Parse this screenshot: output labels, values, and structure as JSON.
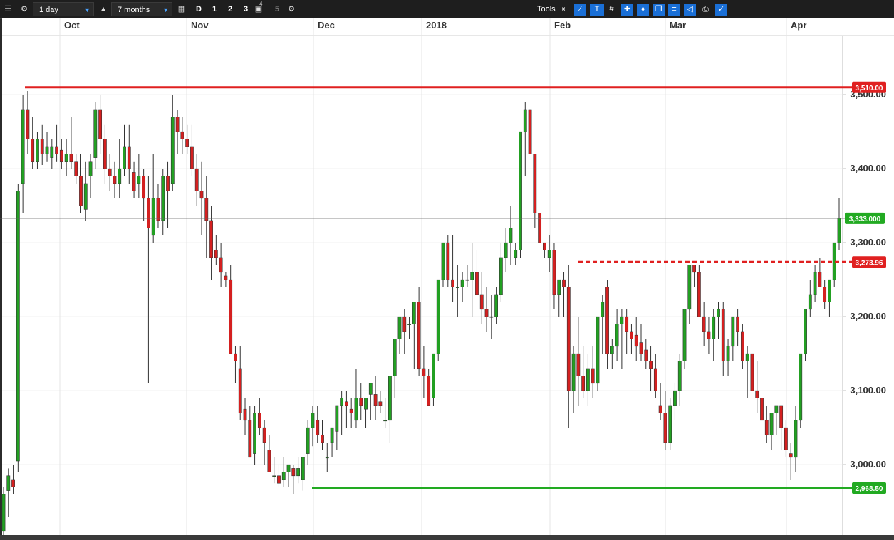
{
  "toolbar": {
    "interval": "1 day",
    "range": "7 months",
    "chart_style_buttons": [
      "D",
      "1",
      "2",
      "3"
    ],
    "sup_label": "4",
    "dim_button": "5",
    "tools_label": "Tools",
    "accent_color": "#1a6fd6",
    "icons": [
      "menu-icon",
      "gear-icon",
      "lock-icon",
      "calendar-icon",
      "layout-icon",
      "settings-icon",
      "back-arrow-icon",
      "trend-line-icon",
      "text-tool-icon",
      "grid-icon",
      "crosshair-icon",
      "marker-icon",
      "copy-icon",
      "fib-icon",
      "tag-icon",
      "print-icon",
      "drawing-tools-icon"
    ]
  },
  "chart_data": {
    "type": "candlestick",
    "x_axis_labels": [
      "Oct",
      "Nov",
      "Dec",
      "2018",
      "Feb",
      "Mar",
      "Apr"
    ],
    "y_tick_labels": [
      "3,500.00",
      "3,400.00",
      "3,300.00",
      "3,200.00",
      "3,100.00",
      "3,000.00"
    ],
    "y_ticks": [
      3500,
      3400,
      3300,
      3200,
      3100,
      3000
    ],
    "ylim": [
      2905,
      3580
    ],
    "colors": {
      "up": "#22a022",
      "down": "#d42020",
      "background": "#ffffff",
      "grid": "#e4e4e4"
    },
    "level_lines": [
      {
        "value": 3510.0,
        "label": "3,510.00",
        "color": "#e02020",
        "style": "solid"
      },
      {
        "value": 3273.96,
        "label": "3,273.96",
        "color": "#e02020",
        "style": "dashed"
      },
      {
        "value": 2968.5,
        "label": "2,968.50",
        "color": "#22aa22",
        "style": "solid"
      }
    ],
    "last_price": {
      "value": 3333.0,
      "label": "3,333.000",
      "color": "#22aa22"
    },
    "candles": [
      [
        2910,
        2970,
        2905,
        2960
      ],
      [
        2965,
        2995,
        2930,
        2985
      ],
      [
        2980,
        3000,
        2960,
        2970
      ],
      [
        3005,
        3380,
        2990,
        3370
      ],
      [
        3380,
        3500,
        3340,
        3480
      ],
      [
        3480,
        3505,
        3420,
        3440
      ],
      [
        3440,
        3470,
        3400,
        3410
      ],
      [
        3410,
        3450,
        3400,
        3440
      ],
      [
        3440,
        3460,
        3405,
        3420
      ],
      [
        3420,
        3450,
        3410,
        3430
      ],
      [
        3415,
        3440,
        3400,
        3430
      ],
      [
        3430,
        3460,
        3410,
        3420
      ],
      [
        3425,
        3440,
        3400,
        3410
      ],
      [
        3410,
        3440,
        3390,
        3420
      ],
      [
        3420,
        3470,
        3400,
        3410
      ],
      [
        3410,
        3420,
        3380,
        3390
      ],
      [
        3390,
        3420,
        3340,
        3350
      ],
      [
        3345,
        3410,
        3330,
        3380
      ],
      [
        3390,
        3420,
        3360,
        3410
      ],
      [
        3415,
        3490,
        3400,
        3480
      ],
      [
        3480,
        3500,
        3420,
        3440
      ],
      [
        3440,
        3460,
        3380,
        3400
      ],
      [
        3400,
        3420,
        3370,
        3390
      ],
      [
        3390,
        3410,
        3360,
        3380
      ],
      [
        3380,
        3440,
        3360,
        3400
      ],
      [
        3400,
        3460,
        3390,
        3430
      ],
      [
        3430,
        3460,
        3380,
        3400
      ],
      [
        3395,
        3410,
        3360,
        3370
      ],
      [
        3380,
        3420,
        3360,
        3390
      ],
      [
        3390,
        3400,
        3330,
        3360
      ],
      [
        3360,
        3390,
        3110,
        3320
      ],
      [
        3310,
        3420,
        3300,
        3360
      ],
      [
        3360,
        3380,
        3320,
        3330
      ],
      [
        3330,
        3400,
        3310,
        3390
      ],
      [
        3390,
        3410,
        3320,
        3370
      ],
      [
        3380,
        3500,
        3370,
        3470
      ],
      [
        3470,
        3480,
        3420,
        3450
      ],
      [
        3450,
        3470,
        3420,
        3440
      ],
      [
        3440,
        3460,
        3420,
        3430
      ],
      [
        3430,
        3460,
        3390,
        3400
      ],
      [
        3400,
        3420,
        3350,
        3370
      ],
      [
        3370,
        3410,
        3310,
        3360
      ],
      [
        3360,
        3390,
        3280,
        3330
      ],
      [
        3330,
        3350,
        3250,
        3280
      ],
      [
        3290,
        3310,
        3270,
        3280
      ],
      [
        3280,
        3300,
        3240,
        3260
      ],
      [
        3255,
        3260,
        3240,
        3250
      ],
      [
        3250,
        3270,
        3200,
        3150
      ],
      [
        3150,
        3160,
        3110,
        3140
      ],
      [
        3130,
        3160,
        3060,
        3070
      ],
      [
        3075,
        3090,
        3040,
        3060
      ],
      [
        3060,
        3080,
        3010,
        3010
      ],
      [
        3015,
        3080,
        3000,
        3070
      ],
      [
        3070,
        3090,
        3040,
        3050
      ],
      [
        3050,
        3060,
        3000,
        3030
      ],
      [
        3020,
        3040,
        2995,
        2990
      ],
      [
        2985,
        3010,
        2975,
        2985
      ],
      [
        2985,
        3000,
        2970,
        2975
      ],
      [
        2980,
        3010,
        2970,
        2990
      ],
      [
        2990,
        3000,
        2970,
        3000
      ],
      [
        2995,
        3000,
        2960,
        2985
      ],
      [
        2985,
        3010,
        2975,
        2995
      ],
      [
        2980,
        3010,
        2965,
        3010
      ],
      [
        3015,
        3060,
        3000,
        3050
      ],
      [
        3050,
        3080,
        3025,
        3070
      ],
      [
        3060,
        3080,
        3030,
        3040
      ],
      [
        3040,
        3060,
        3020,
        3030
      ],
      [
        3010,
        3030,
        2990,
        3010
      ],
      [
        3030,
        3050,
        3010,
        3050
      ],
      [
        3045,
        3070,
        3020,
        3080
      ],
      [
        3080,
        3100,
        3040,
        3090
      ],
      [
        3085,
        3100,
        3050,
        3080
      ],
      [
        3075,
        3090,
        3050,
        3070
      ],
      [
        3060,
        3130,
        3050,
        3090
      ],
      [
        3090,
        3110,
        3060,
        3080
      ],
      [
        3075,
        3090,
        3050,
        3090
      ],
      [
        3095,
        3110,
        3060,
        3110
      ],
      [
        3095,
        3120,
        3060,
        3080
      ],
      [
        3085,
        3100,
        3070,
        3080
      ],
      [
        3060,
        3090,
        3050,
        3060
      ],
      [
        3060,
        3110,
        3030,
        3120
      ],
      [
        3120,
        3130,
        3090,
        3170
      ],
      [
        3170,
        3200,
        3150,
        3200
      ],
      [
        3200,
        3210,
        3150,
        3180
      ],
      [
        3190,
        3200,
        3170,
        3190
      ],
      [
        3190,
        3210,
        3130,
        3220
      ],
      [
        3220,
        3240,
        3120,
        3130
      ],
      [
        3130,
        3160,
        3090,
        3120
      ],
      [
        3120,
        3130,
        3080,
        3080
      ],
      [
        3090,
        3120,
        3080,
        3150
      ],
      [
        3150,
        3230,
        3140,
        3250
      ],
      [
        3250,
        3300,
        3240,
        3300
      ],
      [
        3300,
        3310,
        3240,
        3250
      ],
      [
        3250,
        3310,
        3220,
        3240
      ],
      [
        3240,
        3270,
        3200,
        3240
      ],
      [
        3240,
        3260,
        3220,
        3250
      ],
      [
        3250,
        3270,
        3240,
        3250
      ],
      [
        3250,
        3300,
        3200,
        3260
      ],
      [
        3260,
        3290,
        3240,
        3230
      ],
      [
        3230,
        3260,
        3190,
        3210
      ],
      [
        3210,
        3240,
        3180,
        3200
      ],
      [
        3200,
        3230,
        3170,
        3200
      ],
      [
        3200,
        3240,
        3190,
        3230
      ],
      [
        3230,
        3300,
        3220,
        3280
      ],
      [
        3280,
        3320,
        3260,
        3300
      ],
      [
        3300,
        3350,
        3270,
        3320
      ],
      [
        3280,
        3300,
        3270,
        3290
      ],
      [
        3290,
        3360,
        3280,
        3450
      ],
      [
        3450,
        3490,
        3390,
        3480
      ],
      [
        3480,
        3450,
        3420,
        3420
      ],
      [
        3420,
        3410,
        3320,
        3340
      ],
      [
        3340,
        3330,
        3310,
        3300
      ],
      [
        3300,
        3290,
        3280,
        3290
      ],
      [
        3280,
        3310,
        3260,
        3290
      ],
      [
        3290,
        3300,
        3210,
        3230
      ],
      [
        3230,
        3240,
        3200,
        3250
      ],
      [
        3250,
        3260,
        3200,
        3240
      ],
      [
        3240,
        3270,
        3050,
        3100
      ],
      [
        3100,
        3160,
        3070,
        3150
      ],
      [
        3150,
        3200,
        3080,
        3120
      ],
      [
        3120,
        3160,
        3090,
        3100
      ],
      [
        3100,
        3150,
        3080,
        3130
      ],
      [
        3130,
        3160,
        3090,
        3110
      ],
      [
        3110,
        3180,
        3100,
        3200
      ],
      [
        3200,
        3230,
        3150,
        3220
      ],
      [
        3240,
        3250,
        3130,
        3150
      ],
      [
        3150,
        3170,
        3130,
        3160
      ],
      [
        3160,
        3210,
        3140,
        3190
      ],
      [
        3190,
        3210,
        3130,
        3200
      ],
      [
        3200,
        3210,
        3150,
        3180
      ],
      [
        3180,
        3190,
        3150,
        3170
      ],
      [
        3175,
        3200,
        3140,
        3160
      ],
      [
        3165,
        3190,
        3140,
        3150
      ],
      [
        3155,
        3170,
        3130,
        3140
      ],
      [
        3140,
        3160,
        3100,
        3130
      ],
      [
        3130,
        3150,
        3090,
        3100
      ],
      [
        3080,
        3110,
        3060,
        3070
      ],
      [
        3070,
        3100,
        3020,
        3030
      ],
      [
        3030,
        3090,
        3020,
        3080
      ],
      [
        3080,
        3110,
        3060,
        3100
      ],
      [
        3100,
        3150,
        3080,
        3140
      ],
      [
        3140,
        3190,
        3130,
        3210
      ],
      [
        3210,
        3260,
        3190,
        3270
      ],
      [
        3270,
        3270,
        3240,
        3260
      ],
      [
        3260,
        3270,
        3210,
        3200
      ],
      [
        3200,
        3220,
        3160,
        3180
      ],
      [
        3180,
        3200,
        3150,
        3170
      ],
      [
        3170,
        3210,
        3140,
        3200
      ],
      [
        3200,
        3220,
        3170,
        3210
      ],
      [
        3210,
        3220,
        3120,
        3140
      ],
      [
        3140,
        3170,
        3120,
        3160
      ],
      [
        3160,
        3200,
        3140,
        3200
      ],
      [
        3200,
        3210,
        3160,
        3180
      ],
      [
        3180,
        3190,
        3130,
        3140
      ],
      [
        3140,
        3160,
        3090,
        3150
      ],
      [
        3150,
        3130,
        3100,
        3100
      ],
      [
        3100,
        3140,
        3070,
        3090
      ],
      [
        3090,
        3100,
        3020,
        3060
      ],
      [
        3060,
        3080,
        3030,
        3040
      ],
      [
        3040,
        3060,
        3020,
        3070
      ],
      [
        3070,
        3080,
        3040,
        3080
      ],
      [
        3080,
        3050,
        3020,
        3050
      ],
      [
        3050,
        3060,
        3010,
        3020
      ],
      [
        3015,
        3030,
        2980,
        3010
      ],
      [
        3010,
        3080,
        2990,
        3060
      ],
      [
        3060,
        3140,
        3050,
        3150
      ],
      [
        3150,
        3200,
        3140,
        3210
      ],
      [
        3210,
        3250,
        3200,
        3230
      ],
      [
        3230,
        3270,
        3220,
        3260
      ],
      [
        3260,
        3280,
        3240,
        3240
      ],
      [
        3240,
        3250,
        3210,
        3220
      ],
      [
        3220,
        3240,
        3200,
        3250
      ],
      [
        3250,
        3270,
        3240,
        3300
      ],
      [
        3300,
        3360,
        3290,
        3333
      ]
    ]
  }
}
